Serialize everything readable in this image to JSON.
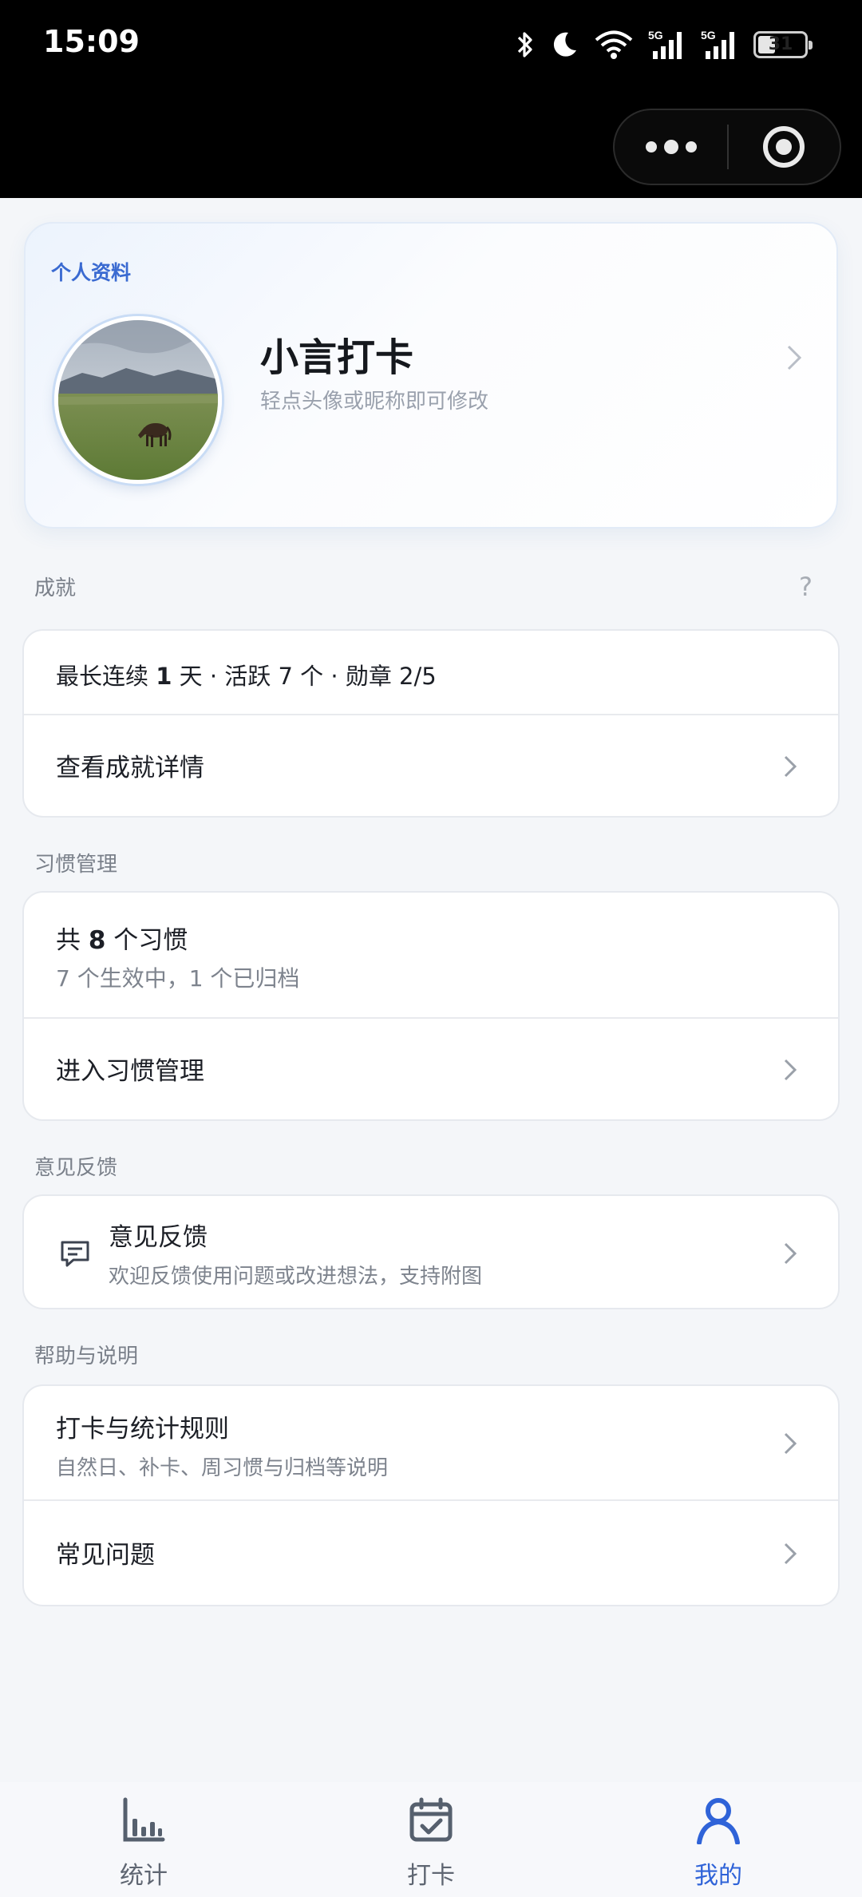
{
  "status_bar": {
    "time": "15:09",
    "network_label_1": "5G",
    "network_label_2": "5G",
    "battery": "31"
  },
  "profile": {
    "section_label": "个人资料",
    "nickname": "小言打卡",
    "hint": "轻点头像或昵称即可修改"
  },
  "achievements": {
    "section_label": "成就",
    "help": "?",
    "summary_prefix": "最长连续 ",
    "summary_days": "1",
    "summary_suffix": " 天 · 活跃 7 个 · 勋章 2/5",
    "detail_label": "查看成就详情"
  },
  "habits": {
    "section_label": "习惯管理",
    "total_prefix": "共 ",
    "total_count": "8",
    "total_suffix": " 个习惯",
    "status_text": "7 个生效中，1 个已归档",
    "manage_label": "进入习惯管理"
  },
  "feedback": {
    "section_label": "意见反馈",
    "title": "意见反馈",
    "subtitle": "欢迎反馈使用问题或改进想法，支持附图"
  },
  "help": {
    "section_label": "帮助与说明",
    "rules_title": "打卡与统计规则",
    "rules_subtitle": "自然日、补卡、周习惯与归档等说明",
    "faq_title": "常见问题"
  },
  "tabbar": {
    "items": [
      {
        "label": "统计",
        "icon": "bar-chart-icon",
        "active": false
      },
      {
        "label": "打卡",
        "icon": "calendar-check-icon",
        "active": false
      },
      {
        "label": "我的",
        "icon": "person-icon",
        "active": true
      }
    ]
  },
  "colors": {
    "accent": "#2f63d8",
    "background": "#f4f6f9",
    "card": "#ffffff"
  }
}
